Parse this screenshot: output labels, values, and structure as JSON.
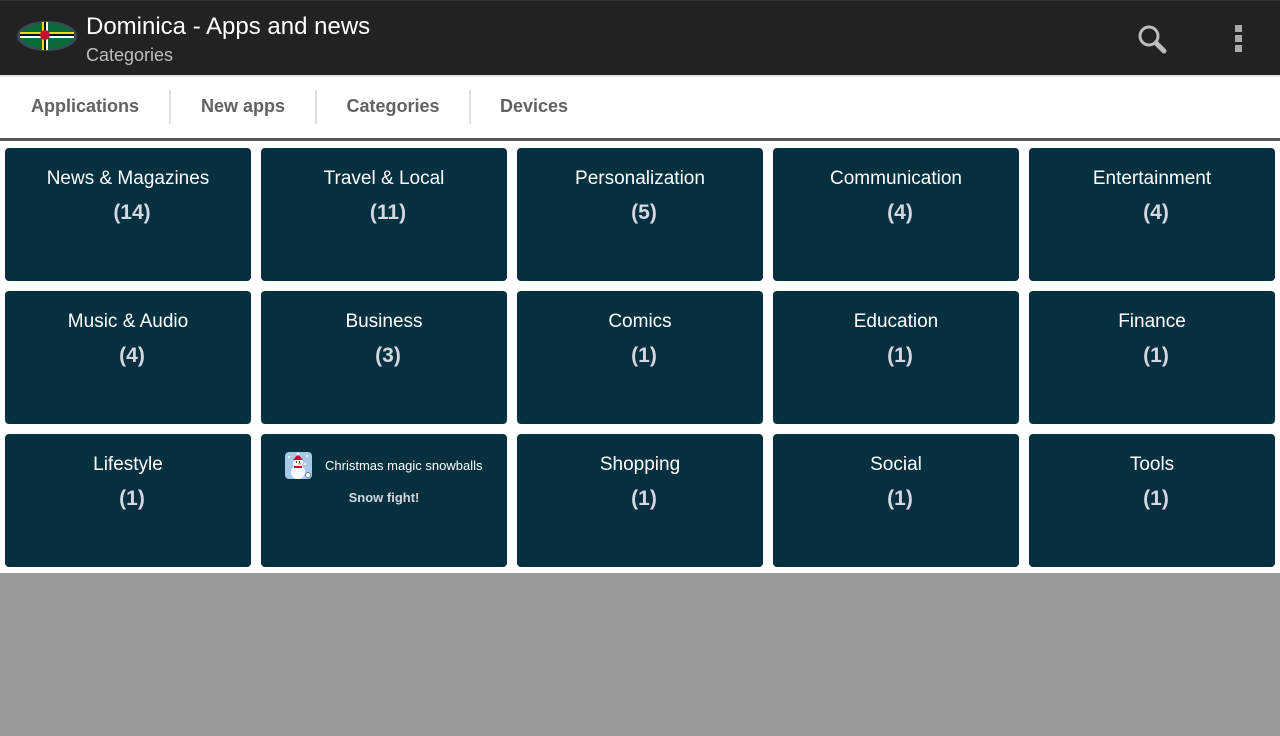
{
  "actionbar": {
    "title": "Dominica - Apps and news",
    "subtitle": "Categories",
    "logo_icon": "dominica-flag-icon",
    "search_icon": "search-icon",
    "overflow_icon": "more-vert-icon"
  },
  "tabs": [
    {
      "label": "Applications",
      "selected": false
    },
    {
      "label": "New apps",
      "selected": false
    },
    {
      "label": "Categories",
      "selected": true
    },
    {
      "label": "Devices",
      "selected": false
    }
  ],
  "categories": [
    {
      "name": "News & Magazines",
      "count": "(14)"
    },
    {
      "name": "Travel & Local",
      "count": "(11)"
    },
    {
      "name": "Personalization",
      "count": "(5)"
    },
    {
      "name": "Communication",
      "count": "(4)"
    },
    {
      "name": "Entertainment",
      "count": "(4)"
    },
    {
      "name": "Music & Audio",
      "count": "(4)"
    },
    {
      "name": "Business",
      "count": "(3)"
    },
    {
      "name": "Comics",
      "count": "(1)"
    },
    {
      "name": "Education",
      "count": "(1)"
    },
    {
      "name": "Finance",
      "count": "(1)"
    },
    {
      "name": "Lifestyle",
      "count": "(1)"
    },
    {
      "name": "Shopping",
      "count": "(1)"
    },
    {
      "name": "Social",
      "count": "(1)"
    },
    {
      "name": "Tools",
      "count": "(1)"
    }
  ],
  "promo": {
    "app_name": "Christmas magic snowballs",
    "description": "Snow fight!",
    "icon": "snowman-app-icon"
  },
  "colors": {
    "actionbar_bg": "#222222",
    "tile_bg": "#043040",
    "tab_text": "#616161",
    "empty_bg": "#999999"
  }
}
